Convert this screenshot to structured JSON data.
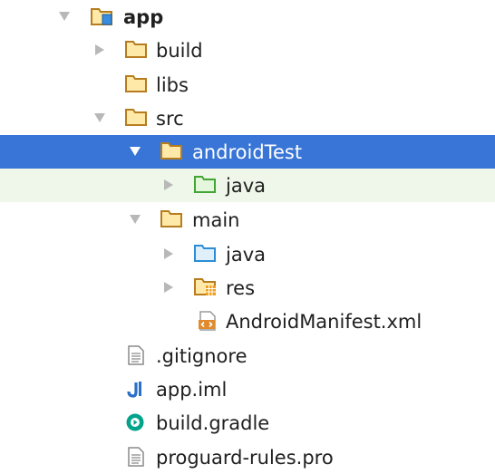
{
  "tree": {
    "app_label": "app",
    "build_label": "build",
    "libs_label": "libs",
    "src_label": "src",
    "android_test_label": "androidTest",
    "android_test_java_label": "java",
    "main_label": "main",
    "main_java_label": "java",
    "res_label": "res",
    "manifest_label": "AndroidManifest.xml",
    "gitignore_label": ".gitignore",
    "app_iml_label": "app.iml",
    "build_gradle_label": "build.gradle",
    "proguard_label": "proguard-rules.pro"
  },
  "colors": {
    "selection_bg": "#3875d6",
    "test_source_bg": "#eef7e9",
    "folder_orange": "#b67c1e",
    "folder_fill": "#ffe9a8",
    "source_blue": "#2b8dd6",
    "test_green": "#42a632",
    "arrow_gray": "#b8b8b8",
    "text": "#202020"
  },
  "icons": [
    "expanded-arrow-icon",
    "collapsed-arrow-icon",
    "module-folder-icon",
    "folder-icon",
    "source-folder-icon",
    "test-source-folder-icon",
    "resource-folder-icon",
    "xml-file-icon",
    "text-file-icon",
    "iml-file-icon",
    "gradle-file-icon"
  ]
}
